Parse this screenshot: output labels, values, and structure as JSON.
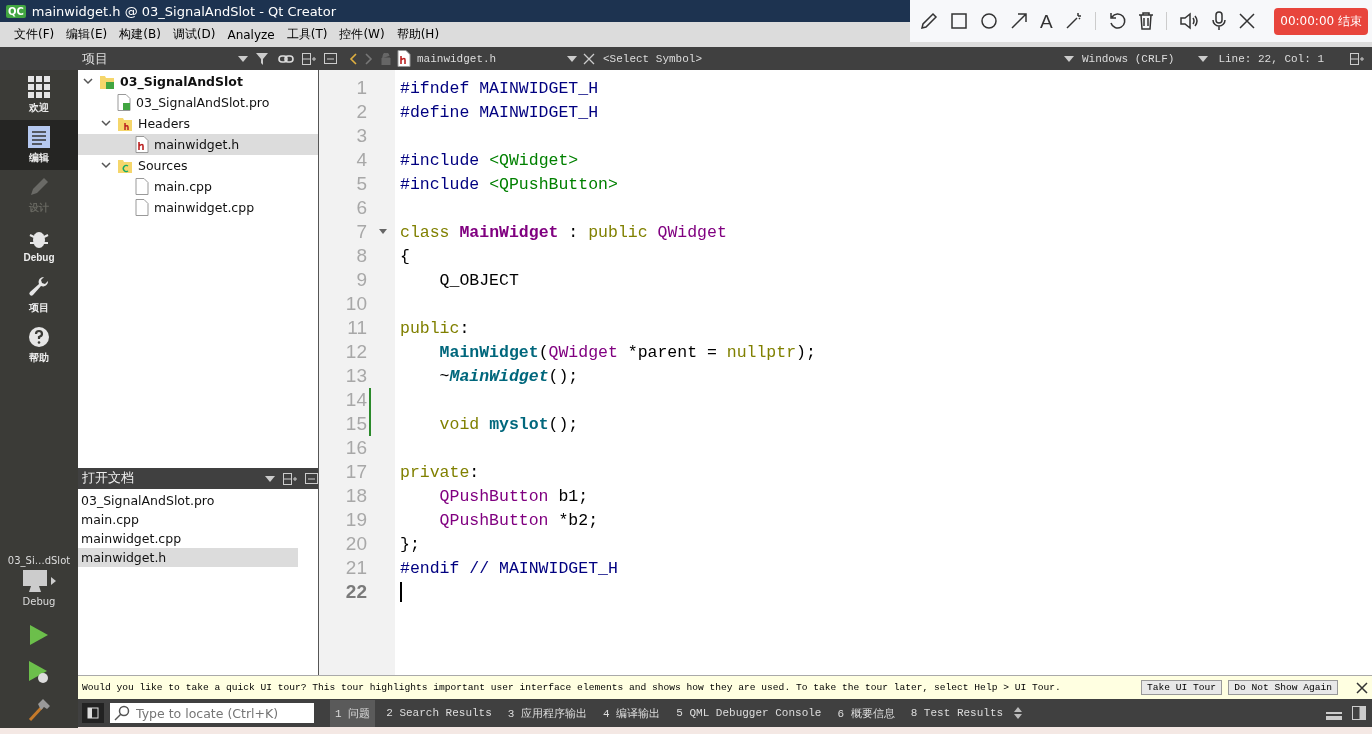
{
  "window": {
    "title": "mainwidget.h @ 03_SignalAndSlot - Qt Creator",
    "app_icon": "QC"
  },
  "menu": [
    "文件(F)",
    "编辑(E)",
    "构建(B)",
    "调试(D)",
    "Analyze",
    "工具(T)",
    "控件(W)",
    "帮助(H)"
  ],
  "recorder": {
    "text_tool": "A",
    "timer": "00:00:00 结束"
  },
  "project_panel": {
    "title": "项目"
  },
  "editor_toolbar": {
    "file": "mainwidget.h",
    "symbol": "<Select Symbol>",
    "line_ending": "Windows (CRLF)",
    "position": "Line: 22, Col: 1"
  },
  "modes": [
    {
      "label": "欢迎",
      "kind": "grid",
      "selected": false,
      "disabled": false
    },
    {
      "label": "编辑",
      "kind": "edit",
      "selected": true,
      "disabled": false
    },
    {
      "label": "设计",
      "kind": "design",
      "selected": false,
      "disabled": true
    },
    {
      "label": "Debug",
      "kind": "debug",
      "selected": false,
      "disabled": false
    },
    {
      "label": "项目",
      "kind": "wrench",
      "selected": false,
      "disabled": false
    },
    {
      "label": "帮助",
      "kind": "help",
      "selected": false,
      "disabled": false
    }
  ],
  "kit": {
    "project": "03_Si…dSlot",
    "build": "Debug"
  },
  "tree": [
    {
      "label": "03_SignalAndSlot",
      "kind": "project",
      "expanded": true,
      "selected": false,
      "children": [
        {
          "label": "03_SignalAndSlot.pro",
          "kind": "pro",
          "selected": false
        },
        {
          "label": "Headers",
          "kind": "header-folder",
          "expanded": true,
          "selected": false,
          "children": [
            {
              "label": "mainwidget.h",
              "kind": "header",
              "selected": true
            }
          ]
        },
        {
          "label": "Sources",
          "kind": "source-folder",
          "expanded": true,
          "selected": false,
          "children": [
            {
              "label": "main.cpp",
              "kind": "source",
              "selected": false
            },
            {
              "label": "mainwidget.cpp",
              "kind": "source",
              "selected": false
            }
          ]
        }
      ]
    }
  ],
  "open_documents": {
    "title": "打开文档",
    "items": [
      {
        "label": "03_SignalAndSlot.pro",
        "selected": false
      },
      {
        "label": "main.cpp",
        "selected": false
      },
      {
        "label": "mainwidget.cpp",
        "selected": false
      },
      {
        "label": "mainwidget.h",
        "selected": true
      }
    ]
  },
  "code": [
    {
      "number": "1",
      "tokens": [
        {
          "text": "#ifndef MAINWIDGET_H",
          "kind": "preprocessor"
        }
      ]
    },
    {
      "number": "2",
      "tokens": [
        {
          "text": "#define MAINWIDGET_H",
          "kind": "preprocessor"
        }
      ]
    },
    {
      "number": "3"
    },
    {
      "number": "4",
      "tokens": [
        {
          "text": "#include ",
          "kind": "preprocessor"
        },
        {
          "text": "<QWidget>",
          "kind": "string"
        }
      ]
    },
    {
      "number": "5",
      "tokens": [
        {
          "text": "#include ",
          "kind": "preprocessor"
        },
        {
          "text": "<QPushButton>",
          "kind": "string"
        }
      ]
    },
    {
      "number": "6"
    },
    {
      "number": "7",
      "foldable": true,
      "tokens": [
        {
          "text": "class ",
          "kind": "keyword"
        },
        {
          "text": "MainWidget",
          "kind": "class-decl"
        },
        {
          "text": " : ",
          "kind": "plain"
        },
        {
          "text": "public ",
          "kind": "keyword"
        },
        {
          "text": "QWidget",
          "kind": "type"
        }
      ]
    },
    {
      "number": "8",
      "tokens": [
        {
          "text": "{",
          "kind": "plain"
        }
      ]
    },
    {
      "number": "9",
      "tokens": [
        {
          "text": "    Q_OBJECT",
          "kind": "plain"
        }
      ]
    },
    {
      "number": "10"
    },
    {
      "number": "11",
      "tokens": [
        {
          "text": "public",
          "kind": "keyword"
        },
        {
          "text": ":",
          "kind": "plain"
        }
      ]
    },
    {
      "number": "12",
      "tokens": [
        {
          "text": "    MainWidget",
          "kind": "function"
        },
        {
          "text": "(",
          "kind": "plain"
        },
        {
          "text": "QWidget",
          "kind": "type"
        },
        {
          "text": " *parent = ",
          "kind": "plain"
        },
        {
          "text": "nullptr",
          "kind": "keyword"
        },
        {
          "text": ");",
          "kind": "plain"
        }
      ]
    },
    {
      "number": "13",
      "tokens": [
        {
          "text": "    ~",
          "kind": "plain"
        },
        {
          "text": "MainWidget",
          "kind": "virtual-function"
        },
        {
          "text": "();",
          "kind": "plain"
        }
      ]
    },
    {
      "number": "14",
      "modified": true
    },
    {
      "number": "15",
      "modified": true,
      "tokens": [
        {
          "text": "    void ",
          "kind": "keyword"
        },
        {
          "text": "myslot",
          "kind": "function"
        },
        {
          "text": "();",
          "kind": "plain"
        }
      ]
    },
    {
      "number": "16"
    },
    {
      "number": "17",
      "tokens": [
        {
          "text": "private",
          "kind": "keyword"
        },
        {
          "text": ":",
          "kind": "plain"
        }
      ]
    },
    {
      "number": "18",
      "tokens": [
        {
          "text": "    QPushButton",
          "kind": "type"
        },
        {
          "text": " b1;",
          "kind": "plain"
        }
      ]
    },
    {
      "number": "19",
      "tokens": [
        {
          "text": "    QPushButton",
          "kind": "type"
        },
        {
          "text": " *b2;",
          "kind": "plain"
        }
      ]
    },
    {
      "number": "20",
      "tokens": [
        {
          "text": "};",
          "kind": "plain"
        }
      ]
    },
    {
      "number": "21",
      "tokens": [
        {
          "text": "#endif // MAINWIDGET_H",
          "kind": "preprocessor"
        }
      ]
    },
    {
      "number": "22",
      "current": true
    }
  ],
  "tour": {
    "message": "Would you like to take a quick UI tour? This tour highlights important user interface elements and shows how they are used. To take the tour later, select Help > UI Tour.",
    "buttons": [
      "Take UI Tour",
      "Do Not Show Again"
    ]
  },
  "locator": {
    "placeholder": "Type to locate (Ctrl+K)"
  },
  "output_tabs": [
    {
      "label": "1 问题",
      "selected": true
    },
    {
      "label": "2 Search Results",
      "selected": false
    },
    {
      "label": "3 应用程序输出",
      "selected": false
    },
    {
      "label": "4 编译输出",
      "selected": false
    },
    {
      "label": "5 QML Debugger Console",
      "selected": false
    },
    {
      "label": "6 概要信息",
      "selected": false
    },
    {
      "label": "8 Test Results",
      "selected": false
    }
  ]
}
